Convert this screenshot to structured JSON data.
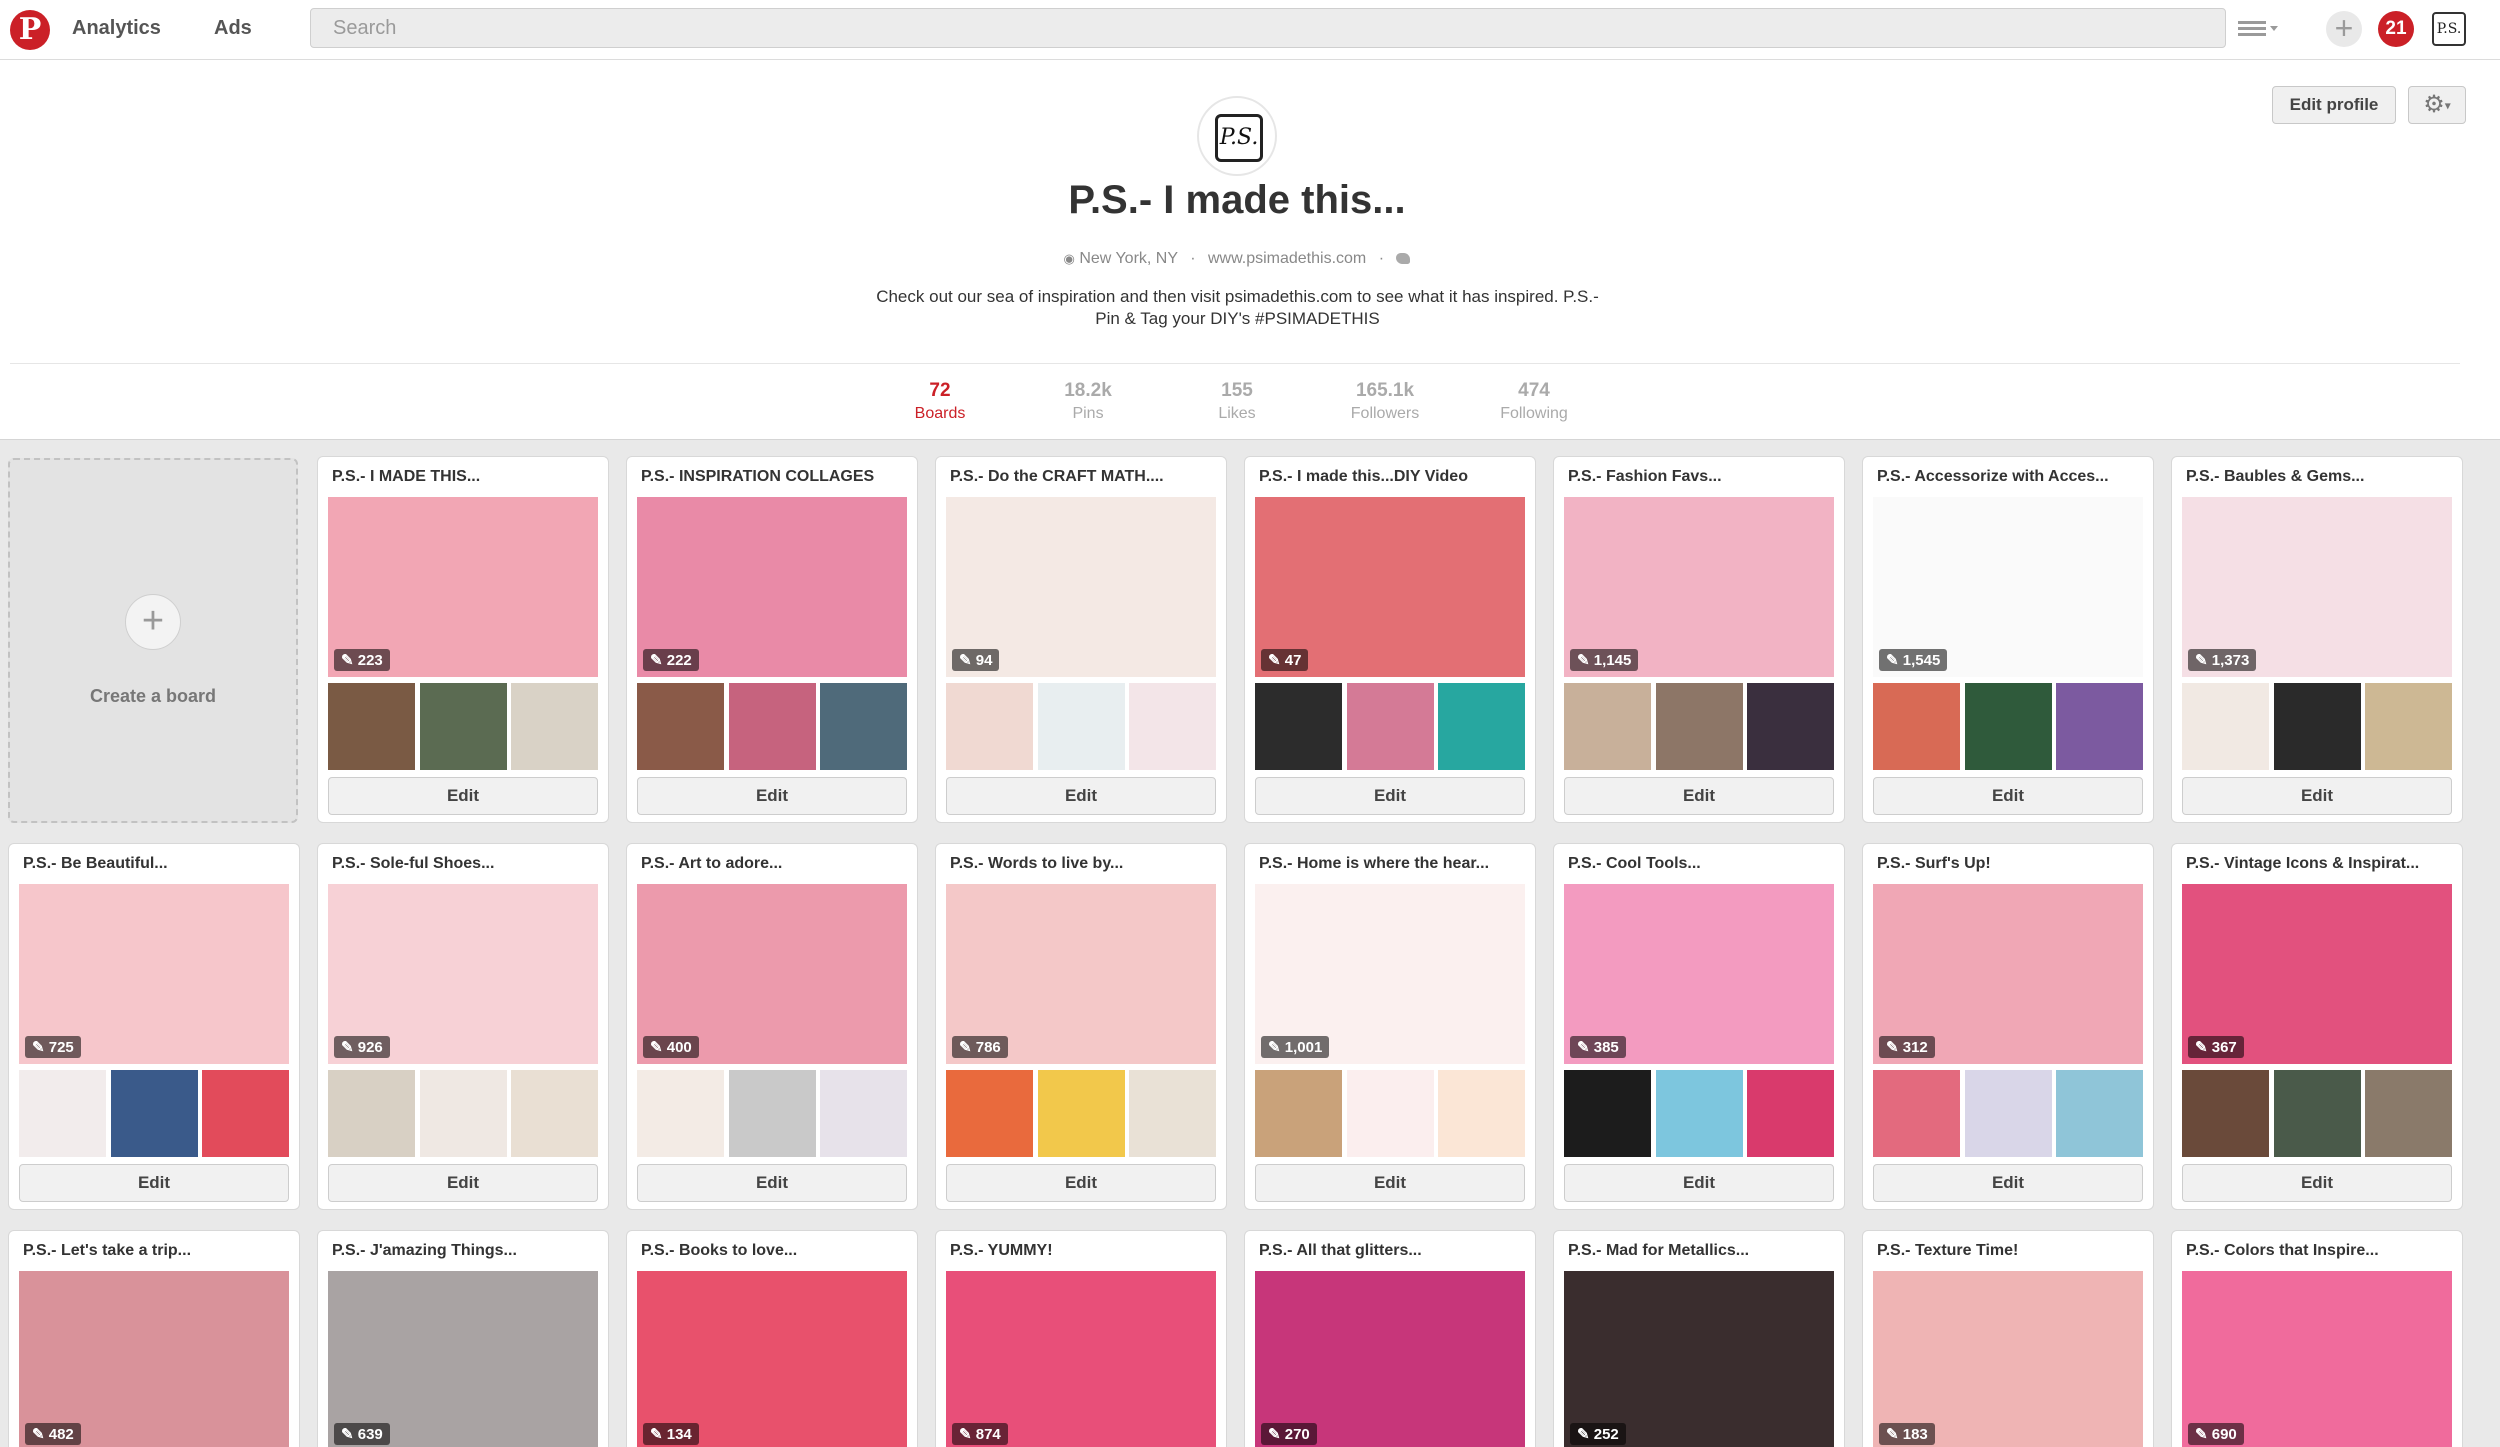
{
  "nav": {
    "logo": "P",
    "analytics": "Analytics",
    "ads": "Ads",
    "search_placeholder": "Search",
    "notifications": "21",
    "avatar": "P.S."
  },
  "profile": {
    "edit_profile": "Edit profile",
    "avatar": "P.S.",
    "name": "P.S.- I made this...",
    "location": "New York, NY",
    "website": "www.psimadethis.com",
    "bio_line1": "Check out our sea of inspiration and then visit psimadethis.com to see what it has inspired. P.S.-",
    "bio_line2": "Pin & Tag your DIY's #PSIMADETHIS"
  },
  "stats": [
    {
      "num": "72",
      "label": "Boards"
    },
    {
      "num": "18.2k",
      "label": "Pins"
    },
    {
      "num": "155",
      "label": "Likes"
    },
    {
      "num": "165.1k",
      "label": "Followers"
    },
    {
      "num": "474",
      "label": "Following"
    }
  ],
  "create_board_label": "Create a board",
  "edit_label": "Edit",
  "colors": {
    "brand": "#cb2027"
  },
  "boards": [
    {
      "title": "P.S.- I MADE THIS...",
      "count": "223",
      "cover": "#f2a6b4",
      "thumbs": [
        "#7a5a44",
        "#5b6b52",
        "#d9d2c6"
      ]
    },
    {
      "title": "P.S.- INSPIRATION COLLAGES",
      "count": "222",
      "cover": "#e98aa7",
      "thumbs": [
        "#8a5a48",
        "#c6637e",
        "#4f6a7a"
      ]
    },
    {
      "title": "P.S.- Do the CRAFT MATH....",
      "count": "94",
      "cover": "#f4e9e4",
      "thumbs": [
        "#f0d9d2",
        "#e8eef0",
        "#f3e5e8"
      ]
    },
    {
      "title": "P.S.- I made this...DIY Video",
      "count": "47",
      "cover": "#e36f74",
      "thumbs": [
        "#2c2c2c",
        "#d47a96",
        "#27a7a0"
      ]
    },
    {
      "title": "P.S.- Fashion Favs...",
      "count": "1,145",
      "cover": "#f2b3c4",
      "thumbs": [
        "#c8b09a",
        "#8d7667",
        "#3a2f3e"
      ]
    },
    {
      "title": "P.S.- Accessorize with Acces...",
      "count": "1,545",
      "cover": "#fafafa",
      "thumbs": [
        "#d86a55",
        "#2f5a3b",
        "#7c5aa0"
      ]
    },
    {
      "title": "P.S.- Baubles & Gems...",
      "count": "1,373",
      "cover": "#f5dfe5",
      "thumbs": [
        "#f1e9e3",
        "#2a2a2a",
        "#cdb894"
      ]
    },
    {
      "title": "P.S.- Be Beautiful...",
      "count": "725",
      "cover": "#f6c6cb",
      "thumbs": [
        "#f2ecec",
        "#3a5a8a",
        "#e24b5b"
      ]
    },
    {
      "title": "P.S.- Sole-ful Shoes...",
      "count": "926",
      "cover": "#f7d1d6",
      "thumbs": [
        "#d8d0c4",
        "#efe8e3",
        "#e9dfd3"
      ]
    },
    {
      "title": "P.S.- Art to adore...",
      "count": "400",
      "cover": "#ec9aac",
      "thumbs": [
        "#f3ebe5",
        "#c9c9c9",
        "#e7e2ea"
      ]
    },
    {
      "title": "P.S.- Words to live by...",
      "count": "786",
      "cover": "#f4c8c8",
      "thumbs": [
        "#e96a3d",
        "#f2c84b",
        "#e9e1d6"
      ]
    },
    {
      "title": "P.S.- Home is where the hear...",
      "count": "1,001",
      "cover": "#fbf0ef",
      "thumbs": [
        "#c9a27a",
        "#fbeeee",
        "#fbe6d6"
      ]
    },
    {
      "title": "P.S.- Cool Tools...",
      "count": "385",
      "cover": "#f39bc0",
      "thumbs": [
        "#1c1c1c",
        "#7dc6de",
        "#d93a6c"
      ]
    },
    {
      "title": "P.S.- Surf's Up!",
      "count": "312",
      "cover": "#f0a7b5",
      "thumbs": [
        "#e36a7e",
        "#d9d6e8",
        "#8fc5d8"
      ]
    },
    {
      "title": "P.S.- Vintage Icons & Inspirat...",
      "count": "367",
      "cover": "#e2517e",
      "thumbs": [
        "#6a4a3a",
        "#4a5a4a",
        "#8a7a6a"
      ]
    },
    {
      "title": "P.S.- Let's take a trip...",
      "count": "482",
      "cover": "#d9929a",
      "thumbs": []
    },
    {
      "title": "P.S.- J'amazing Things...",
      "count": "639",
      "cover": "#a9a3a3",
      "thumbs": []
    },
    {
      "title": "P.S.- Books to love...",
      "count": "134",
      "cover": "#e8516c",
      "thumbs": []
    },
    {
      "title": "P.S.- YUMMY!",
      "count": "874",
      "cover": "#e84f79",
      "thumbs": []
    },
    {
      "title": "P.S.- All that glitters...",
      "count": "270",
      "cover": "#c7367a",
      "thumbs": []
    },
    {
      "title": "P.S.- Mad for Metallics...",
      "count": "252",
      "cover": "#3a2d2e",
      "thumbs": []
    },
    {
      "title": "P.S.- Texture Time!",
      "count": "183",
      "cover": "#efb4b4",
      "thumbs": []
    },
    {
      "title": "P.S.- Colors that Inspire...",
      "count": "690",
      "cover": "#f06b9c",
      "thumbs": []
    }
  ]
}
